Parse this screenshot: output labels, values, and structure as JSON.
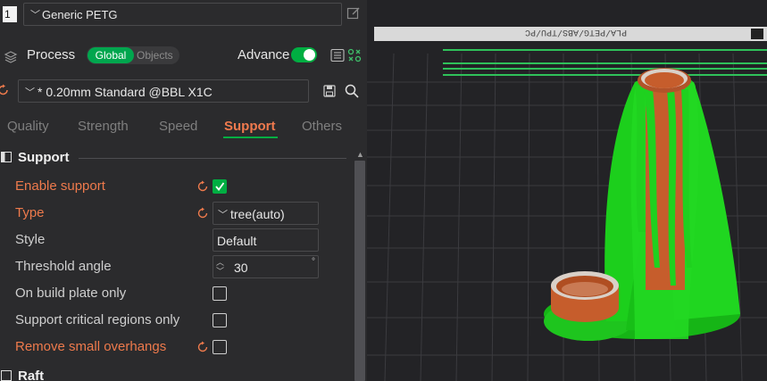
{
  "filament": {
    "index": "1",
    "name": "Generic PETG"
  },
  "process": {
    "title": "Process",
    "scope_global": "Global",
    "scope_objects": "Objects",
    "advanced_label": "Advance",
    "advanced_on": true
  },
  "preset": {
    "name": "* 0.20mm Standard @BBL X1C"
  },
  "tabs": [
    "Quality",
    "Strength",
    "Speed",
    "Support",
    "Others"
  ],
  "active_tab": "Support",
  "support": {
    "title": "Support",
    "options": [
      {
        "label": "Enable support",
        "modified": true,
        "checked": true
      },
      {
        "label": "Type",
        "modified": true,
        "value": "tree(auto)"
      },
      {
        "label": "Style",
        "modified": false,
        "value": "Default"
      },
      {
        "label": "Threshold angle",
        "modified": false,
        "value": "30",
        "unit": "°"
      },
      {
        "label": "On build plate only",
        "modified": false,
        "checked": false
      },
      {
        "label": "Support critical regions only",
        "modified": false,
        "checked": false
      },
      {
        "label": "Remove small overhangs",
        "modified": true,
        "checked": false
      }
    ]
  },
  "raft": {
    "title": "Raft"
  },
  "plate_label": "PLA/PETG/ABS/TPU/PC",
  "colors": {
    "accent_green": "#00ae42",
    "modified_orange": "#ee7a4c",
    "support_green": "#1fd11f",
    "model_orange": "#c9622f"
  }
}
